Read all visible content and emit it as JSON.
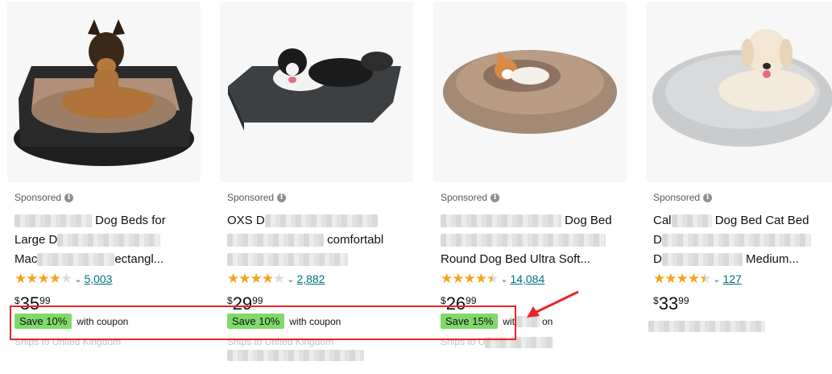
{
  "products": [
    {
      "sponsored": "Sponsored",
      "title_lines": [
        "",
        "Large D",
        "Mac"
      ],
      "title_tails": [
        "Dog Beds for",
        "",
        "ectangl..."
      ],
      "reviews": "5,003",
      "price_symbol": "$",
      "price_whole": "35",
      "price_fraction": "99",
      "coupon_badge": "Save 10%",
      "coupon_text": "with coupon",
      "ships": "Ships to United Kingdom"
    },
    {
      "sponsored": "Sponsored",
      "title_lines": [
        "OXS D",
        "",
        ""
      ],
      "title_tails": [
        "",
        "comfortabl",
        ""
      ],
      "reviews": "2,882",
      "price_symbol": "$",
      "price_whole": "29",
      "price_fraction": "99",
      "coupon_badge": "Save 10%",
      "coupon_text": "with coupon",
      "ships": "Ships to United Kingdom"
    },
    {
      "sponsored": "Sponsored",
      "title_lines": [
        "",
        "",
        "Round Dog Bed Ultra Soft..."
      ],
      "title_tails": [
        "Dog Bed",
        "",
        ""
      ],
      "reviews": "14,084",
      "price_symbol": "$",
      "price_whole": "26",
      "price_fraction": "99",
      "coupon_badge": "Save 15%",
      "coupon_text": "wit",
      "coupon_tail": "on",
      "ships": "Ships to U"
    },
    {
      "sponsored": "Sponsored",
      "title_lines": [
        "Cal",
        "D",
        "D"
      ],
      "title_tails": [
        "Dog Bed Cat Bed",
        "",
        "Medium..."
      ],
      "reviews": "127",
      "price_symbol": "$",
      "price_whole": "33",
      "price_fraction": "99"
    }
  ],
  "icons": {
    "info": "info-icon",
    "stars": "star-rating-icon",
    "chevron": "chevron-down-icon",
    "arrow": "red-arrow-annotation"
  },
  "ratings": {
    "p1": 4.0,
    "p2": 4.0,
    "p3": 4.5,
    "p4": 4.5
  },
  "colors": {
    "coupon_badge": "#7fda69",
    "link": "#007185",
    "star": "#f4a41c",
    "annotation": "#e8242a"
  },
  "glyphs": {
    "info": "i",
    "chevron": "⌄"
  }
}
